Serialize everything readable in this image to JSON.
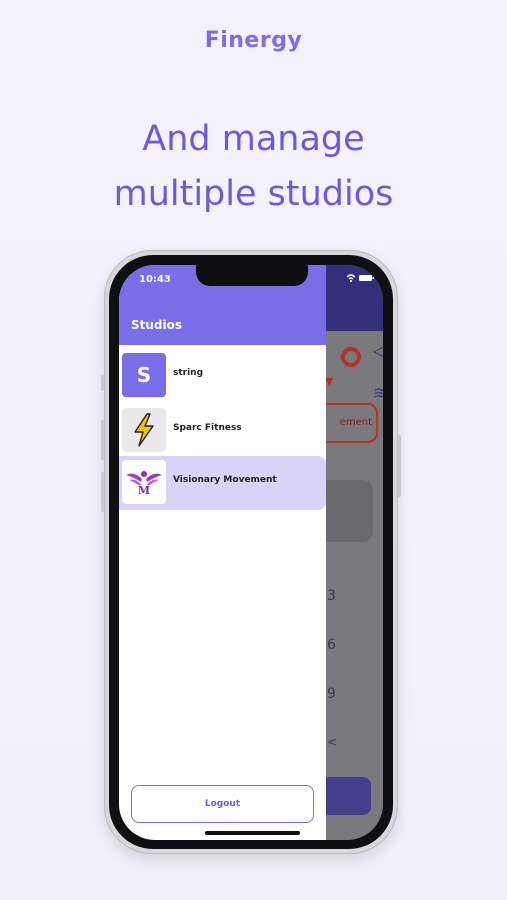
{
  "brand": {
    "logo": "Finergy"
  },
  "headline": {
    "line1": "And manage",
    "line2": "multiple studios"
  },
  "phone": {
    "status_time": "10:43",
    "drawer_title": "Studios",
    "studios": [
      {
        "name": "string",
        "initial": "S",
        "thumb": "initial-letter"
      },
      {
        "name": "Sparc Fitness",
        "thumb": "lightning-bolt-icon"
      },
      {
        "name": "Visionary Movement",
        "thumb": "visionary-movement-logo",
        "selected": true
      }
    ],
    "logout_label": "Logout",
    "background_app": {
      "pill_fragment": "ement",
      "numbers": [
        "3",
        "6",
        "9",
        "<"
      ]
    }
  },
  "colors": {
    "accent": "#7a6ee8",
    "headline": "#6a5cd6",
    "selected_row": "#d9d3f7",
    "header_dark": "#33307a",
    "alert_red": "#b5312b"
  }
}
